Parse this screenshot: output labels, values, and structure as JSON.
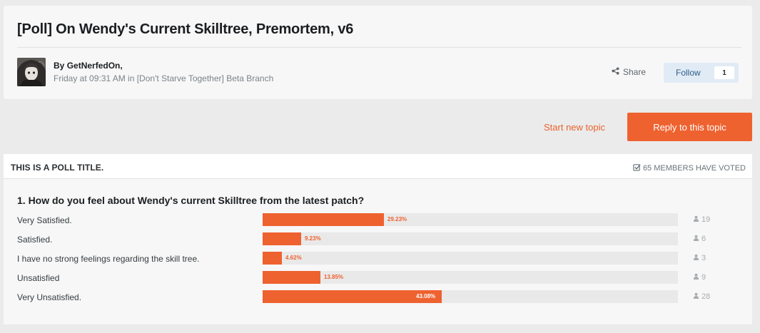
{
  "topic": {
    "title": "[Poll] On Wendy's Current Skilltree, Premortem, v6",
    "by_prefix": "By ",
    "author": "GetNerfedOn,",
    "meta": "Friday at 09:31 AM in [Don't Starve Together] Beta Branch",
    "share_label": "Share",
    "follow_label": "Follow",
    "follow_count": "1"
  },
  "actions": {
    "start_topic": "Start new topic",
    "reply": "Reply to this topic"
  },
  "poll": {
    "title": "THIS IS A POLL TITLE.",
    "voted": "65 MEMBERS HAVE VOTED",
    "question": "1. How do you feel about Wendy's current Skilltree from the latest patch?",
    "choices": [
      {
        "label": "Very Satisfied.",
        "percent": 29.23,
        "percent_label": "29.23%",
        "votes": "19"
      },
      {
        "label": "Satisfied.",
        "percent": 9.23,
        "percent_label": "9.23%",
        "votes": "6"
      },
      {
        "label": "I have no strong feelings regarding the skill tree.",
        "percent": 4.62,
        "percent_label": "4.62%",
        "votes": "3"
      },
      {
        "label": "Unsatisfied",
        "percent": 13.85,
        "percent_label": "13.85%",
        "votes": "9"
      },
      {
        "label": "Very Unsatisfied.",
        "percent": 43.08,
        "percent_label": "43.08%",
        "votes": "28"
      }
    ]
  },
  "colors": {
    "accent": "#ee6230",
    "follow_bg": "#e1ebf5",
    "bar_track": "#e9e9e9"
  },
  "icons": {
    "share": "share-icon",
    "voted": "checkbox-icon",
    "votes": "user-icon"
  }
}
